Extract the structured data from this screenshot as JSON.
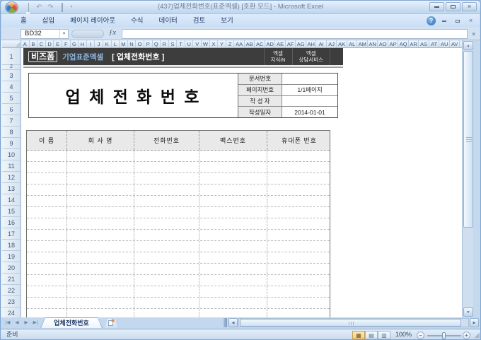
{
  "window": {
    "title": "(437)업체전화번호(표준엑셀) [호환 모드] - Microsoft Excel"
  },
  "ribbon": {
    "tabs": [
      "홈",
      "삽입",
      "페이지 레이아웃",
      "수식",
      "데이터",
      "검토",
      "보기"
    ]
  },
  "formula_bar": {
    "name_box": "BD32",
    "insert_function": "ƒx",
    "formula": ""
  },
  "icons": {
    "undo": "↶",
    "redo": "↷",
    "qat_dropdown": "▾",
    "namebox_dropdown": "▾",
    "formula_expand": "«",
    "help": "?",
    "close": "×",
    "scroll_up": "▲",
    "scroll_down": "▼",
    "scroll_left": "◀",
    "scroll_right": "▶",
    "tab_first": "|◀",
    "tab_prev": "◀",
    "tab_next": "▶",
    "tab_last": "▶|",
    "view_normal": "▦",
    "view_page_layout": "▤",
    "view_page_break": "▥",
    "zoom_out": "−",
    "zoom_in": "+",
    "resize_grip": "◢"
  },
  "sheet": {
    "columns": [
      "A",
      "B",
      "C",
      "D",
      "E",
      "F",
      "G",
      "H",
      "I",
      "J",
      "K",
      "L",
      "M",
      "N",
      "O",
      "P",
      "Q",
      "R",
      "S",
      "T",
      "U",
      "V",
      "W",
      "X",
      "Y",
      "Z",
      "AA",
      "AB",
      "AC",
      "AD",
      "AE",
      "AF",
      "AG",
      "AH",
      "AI",
      "AJ",
      "AK",
      "AL",
      "AM",
      "AN",
      "AO",
      "AP",
      "AQ",
      "AR",
      "AS",
      "AT",
      "AU",
      "AV"
    ],
    "rows": [
      1,
      2,
      3,
      4,
      5,
      6,
      7,
      8,
      9,
      10,
      11,
      12,
      13,
      14,
      15,
      16,
      17,
      18,
      19,
      20,
      21,
      22,
      23,
      24
    ]
  },
  "banner": {
    "logo": "비즈폼",
    "brand": "기업표준엑셀",
    "doc_title": "[ 업체전화번호 ]",
    "links": [
      {
        "line1": "엑셀",
        "line2": "지식iN"
      },
      {
        "line1": "엑셀",
        "line2": "상담서비스"
      }
    ]
  },
  "doc": {
    "title": "업 체 전 화 번 호",
    "info": {
      "rows": [
        {
          "label": "문서번호",
          "value": ""
        },
        {
          "label": "페이지번호",
          "value": "1/1페이지"
        },
        {
          "label": "작 성 자",
          "value": ""
        },
        {
          "label": "작성일자",
          "value": "2014-01-01"
        }
      ]
    },
    "table": {
      "headers": [
        "이 름",
        "회 사 명",
        "전화번호",
        "팩스번호",
        "휴대폰 번호"
      ],
      "empty_rows": 15
    }
  },
  "sheet_tabs": {
    "active": "업체전화번호"
  },
  "status": {
    "ready": "준비",
    "zoom": "100%"
  },
  "colors": {
    "banner_bg": "#3d3d3d",
    "brand_blue": "#8fb7e2",
    "header_fill": "#e9e9e9"
  }
}
